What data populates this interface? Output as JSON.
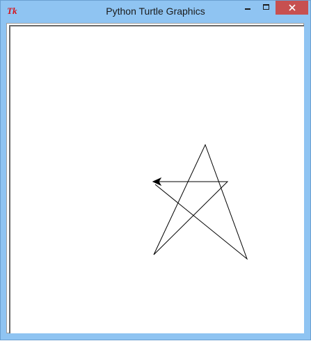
{
  "window": {
    "title": "Python Turtle Graphics",
    "app_icon_text": "Tk"
  },
  "colors": {
    "titlebar": "#8fc4f2",
    "close_button": "#c75050",
    "canvas": "#ffffff",
    "pen": "#000000"
  },
  "icons": {
    "app": "tk-feather-icon",
    "minimize": "minimize-icon",
    "maximize": "maximize-icon",
    "close": "close-icon",
    "turtle": "arrow-turtle-cursor"
  }
}
